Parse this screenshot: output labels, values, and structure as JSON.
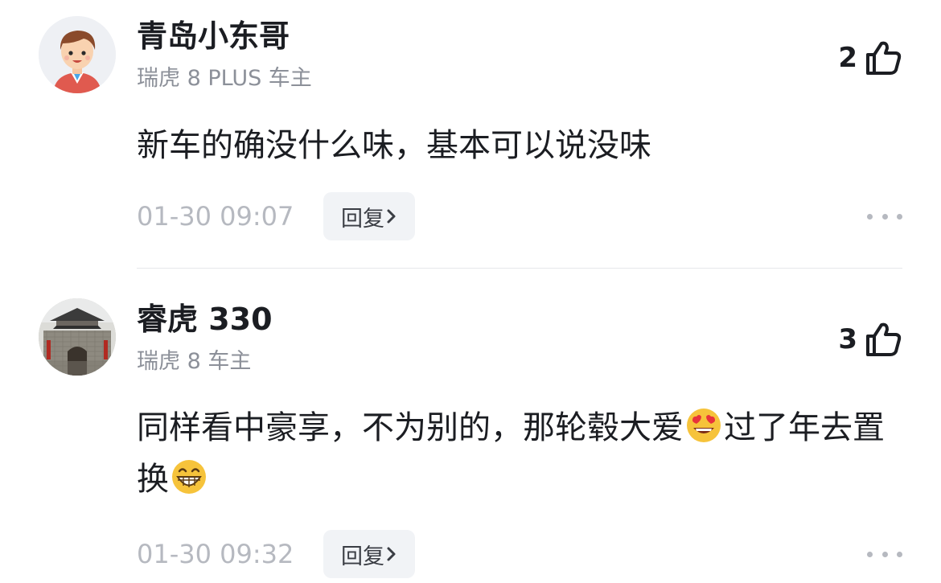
{
  "comments": [
    {
      "username": "青岛小东哥",
      "car_tag": "瑞虎 8 PLUS 车主",
      "like_count": "2",
      "content": "新车的确没什么味，基本可以说没味",
      "time": "01-30 09:07",
      "reply_label": "回复",
      "avatar_icon": "cartoon-boy-avatar"
    },
    {
      "username": "睿虎 330",
      "car_tag": "瑞虎 8 车主",
      "like_count": "3",
      "content_part1": "同样看中豪享，不为别的，那轮毂大爱",
      "content_part2": "过了年去置换",
      "time": "01-30 09:32",
      "reply_label": "回复",
      "avatar_icon": "city-gate-photo-avatar",
      "emojis": [
        "heart-eyes-emoji",
        "grinning-emoji"
      ]
    }
  ],
  "icons": {
    "like": "thumbs-up-icon",
    "more": "more-dots-icon",
    "reply_arrow": "chevron-right-icon"
  }
}
